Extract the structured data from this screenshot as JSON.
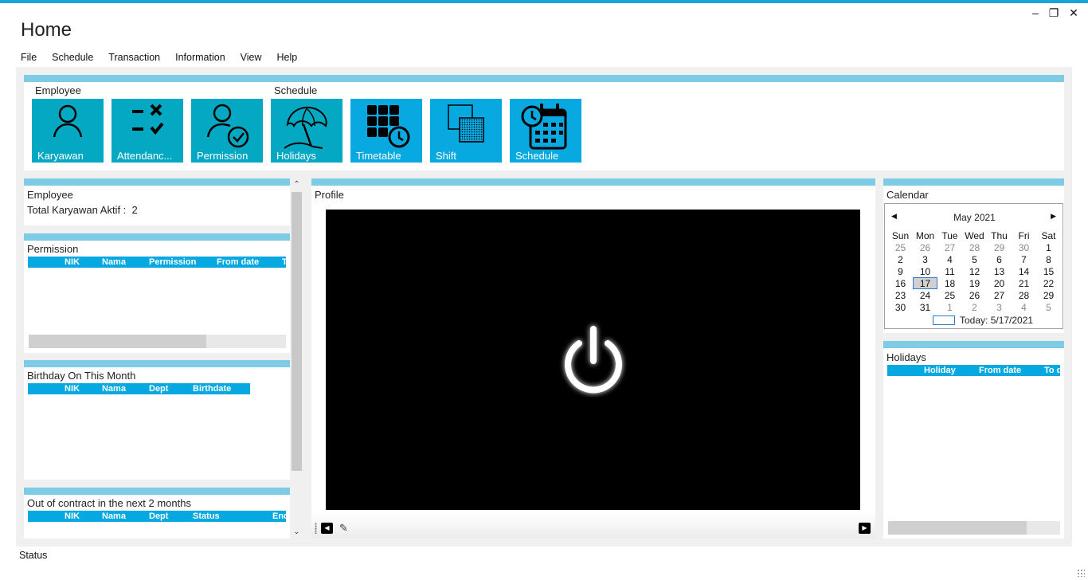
{
  "window": {
    "title": "Home",
    "controls": {
      "minimize": "–",
      "restore": "❐",
      "close": "✕"
    }
  },
  "menu": [
    "File",
    "Schedule",
    "Transaction",
    "Information",
    "View",
    "Help"
  ],
  "ribbon": {
    "groups": {
      "employee": "Employee",
      "schedule": "Schedule"
    },
    "tiles": [
      {
        "label": "Karyawan",
        "icon": "person-icon"
      },
      {
        "label": "Attendanc...",
        "icon": "attendance-icon"
      },
      {
        "label": "Permission",
        "icon": "person-check-icon"
      },
      {
        "label": "Holidays",
        "icon": "beach-umbrella-icon"
      },
      {
        "label": "Timetable",
        "icon": "grid-clock-icon"
      },
      {
        "label": "Shift",
        "icon": "shift-icon"
      },
      {
        "label": "Schedule",
        "icon": "calendar-clock-icon"
      }
    ]
  },
  "left": {
    "employee": {
      "title": "Employee",
      "total_label": "Total Karyawan Aktif :",
      "total_value": "2"
    },
    "permission": {
      "title": "Permission",
      "columns": [
        "NIK",
        "Nama",
        "Permission",
        "From date",
        "T"
      ]
    },
    "birthday": {
      "title": "Birthday On This Month",
      "columns": [
        "NIK",
        "Nama",
        "Dept",
        "Birthdate"
      ]
    },
    "contract": {
      "title": "Out of contract in the next 2 months",
      "columns": [
        "NIK",
        "Nama",
        "Dept",
        "Status",
        "End"
      ]
    }
  },
  "profile": {
    "title": "Profile",
    "icon": "power-icon"
  },
  "calendar": {
    "title": "Calendar",
    "month": "May 2021",
    "weekdays": [
      "Sun",
      "Mon",
      "Tue",
      "Wed",
      "Thu",
      "Fri",
      "Sat"
    ],
    "weeks": [
      [
        "25",
        "26",
        "27",
        "28",
        "29",
        "30",
        "1"
      ],
      [
        "2",
        "3",
        "4",
        "5",
        "6",
        "7",
        "8"
      ],
      [
        "9",
        "10",
        "11",
        "12",
        "13",
        "14",
        "15"
      ],
      [
        "16",
        "17",
        "18",
        "19",
        "20",
        "21",
        "22"
      ],
      [
        "23",
        "24",
        "25",
        "26",
        "27",
        "28",
        "29"
      ],
      [
        "30",
        "31",
        "1",
        "2",
        "3",
        "4",
        "5"
      ]
    ],
    "selected": "17",
    "today": "Today: 5/17/2021"
  },
  "holidays": {
    "title": "Holidays",
    "columns": [
      "Holiday",
      "From date",
      "To d"
    ]
  },
  "status": "Status",
  "colors": {
    "accent": "#1aa3d6",
    "band": "#7ecbe6",
    "tile_teal": "#05a8c2",
    "tile_blue": "#08a9e0"
  }
}
